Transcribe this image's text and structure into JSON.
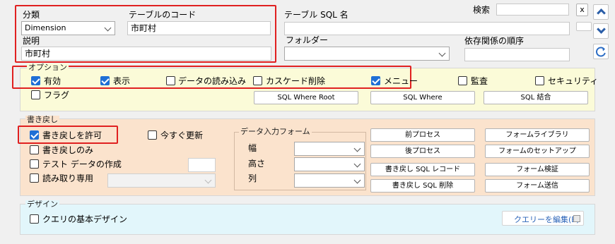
{
  "header": {
    "category_label": "分類",
    "category_value": "Dimension",
    "table_code_label": "テーブルのコード",
    "table_code_value": "市町村",
    "description_label": "説明",
    "description_value": "市町村",
    "table_sql_name_label": "テーブル SQL 名",
    "table_sql_name_value": "",
    "folder_label": "フォルダー",
    "folder_value": "",
    "dependency_order_label": "依存関係の順序",
    "dependency_order_value": "",
    "search_label": "検索",
    "search_value": "",
    "clear_label": "x"
  },
  "options": {
    "legend": "オプション",
    "enabled": {
      "label": "有効",
      "checked": true
    },
    "display": {
      "label": "表示",
      "checked": true
    },
    "data_loading": {
      "label": "データの読み込み",
      "checked": false
    },
    "cascade_delete": {
      "label": "カスケード削除",
      "checked": false
    },
    "menu": {
      "label": "メニュー",
      "checked": true
    },
    "audit": {
      "label": "監査",
      "checked": false
    },
    "security": {
      "label": "セキュリティ",
      "checked": false
    },
    "flag": {
      "label": "フラグ",
      "checked": false
    },
    "sql_where_root": "SQL Where Root",
    "sql_where": "SQL Where",
    "sql_join": "SQL 結合"
  },
  "writeback": {
    "legend": "書き戻し",
    "allow": {
      "label": "書き戻しを許可",
      "checked": true
    },
    "update_now": {
      "label": "今すぐ更新",
      "checked": false
    },
    "writeback_only": {
      "label": "書き戻しのみ",
      "checked": false
    },
    "test_data": {
      "label": "テスト データの作成",
      "checked": false
    },
    "test_data_value": "",
    "read_only": {
      "label": "読み取り専用",
      "checked": false
    },
    "read_only_value": "",
    "data_entry_form": {
      "legend": "データ入力フォーム",
      "width_label": "幅",
      "height_label": "高さ",
      "column_label": "列",
      "width_value": "",
      "height_value": "",
      "column_value": ""
    },
    "buttons": {
      "pre_process": "前プロセス",
      "post_process": "後プロセス",
      "writeback_sql_record": "書き戻し SQL レコード",
      "writeback_sql_delete": "書き戻し SQL 削除",
      "form_library": "フォームライブラリ",
      "form_setup": "フォームのセットアップ",
      "form_validation": "フォーム検証",
      "form_submit": "フォーム送信"
    }
  },
  "design": {
    "legend": "デザイン",
    "query_basic_design": {
      "label": "クエリの基本デザイン",
      "checked": false
    },
    "edit_query_button": "クエリーを編集(E)"
  },
  "side": {
    "up_icon": "chevron-up-icon",
    "down_icon": "chevron-down-icon",
    "refresh_icon": "refresh-icon"
  },
  "colors": {
    "highlight": "#e02020",
    "options_bg": "#fbfbd8",
    "writeback_bg": "#fbe3cd",
    "design_bg": "#e2f6fb",
    "checkbox_on": "#1f6fd6"
  }
}
